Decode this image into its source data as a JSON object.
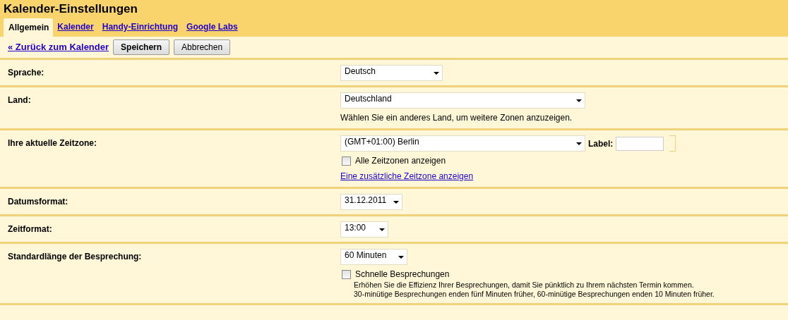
{
  "title": "Kalender-Einstellungen",
  "tabs": [
    {
      "label": "Allgemein",
      "selected": true
    },
    {
      "label": "Kalender",
      "selected": false
    },
    {
      "label": "Handy-Einrichtung",
      "selected": false
    },
    {
      "label": "Google Labs",
      "selected": false
    }
  ],
  "toolbar": {
    "back_link": "« Zurück zum Kalender",
    "buttons": [
      {
        "label": "Speichern",
        "primary": true
      },
      {
        "label": "Abbrechen",
        "primary": false
      }
    ]
  },
  "settings": [
    {
      "label": "Sprache:",
      "controls": [
        {
          "kind": "select",
          "value": "Deutsch"
        }
      ]
    },
    {
      "label": "Land:",
      "controls": [
        {
          "kind": "select",
          "value": "Deutschland"
        },
        {
          "kind": "hint",
          "text": "Wählen Sie ein anderes Land, um weitere Zonen anzuzeigen."
        }
      ]
    },
    {
      "label": "Ihre aktuelle Zeitzone:",
      "controls": [
        {
          "kind": "select",
          "value": "(GMT+01:00) Berlin",
          "field_label": "Label:"
        },
        {
          "kind": "checkbox",
          "label": "Alle Zeitzonen anzeigen",
          "checked": false
        },
        {
          "kind": "link",
          "text": "Eine zusätzliche Zeitzone anzeigen"
        }
      ]
    },
    {
      "label": "Datumsformat:",
      "controls": [
        {
          "kind": "select",
          "value": "31.12.2011"
        }
      ]
    },
    {
      "label": "Zeitformat:",
      "controls": [
        {
          "kind": "select",
          "value": "13:00"
        }
      ]
    },
    {
      "label": "Standardlänge der Besprechung:",
      "controls": [
        {
          "kind": "select",
          "value": "60 Minuten"
        },
        {
          "kind": "checkbox",
          "label": "Schnelle Besprechungen",
          "checked": false,
          "description": [
            "Erhöhen Sie die Effizienz Ihrer Besprechungen, damit Sie pünktlich zu Ihrem nächsten Termin kommen.",
            "30-minütige Besprechungen enden fünf Minuten früher, 60-minütige Besprechungen enden 10 Minuten früher."
          ]
        }
      ]
    }
  ]
}
